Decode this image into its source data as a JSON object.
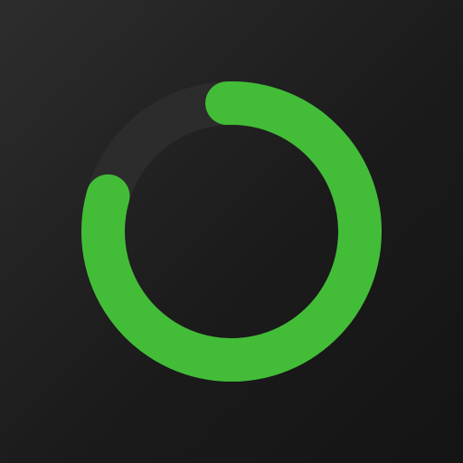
{
  "icon": {
    "name": "activity-ring-icon",
    "progress_percent": 80,
    "colors": {
      "background_light": "#2d2d2d",
      "background_dark": "#141414",
      "track": "#2c2c2c",
      "progress": "#43bd38"
    }
  }
}
